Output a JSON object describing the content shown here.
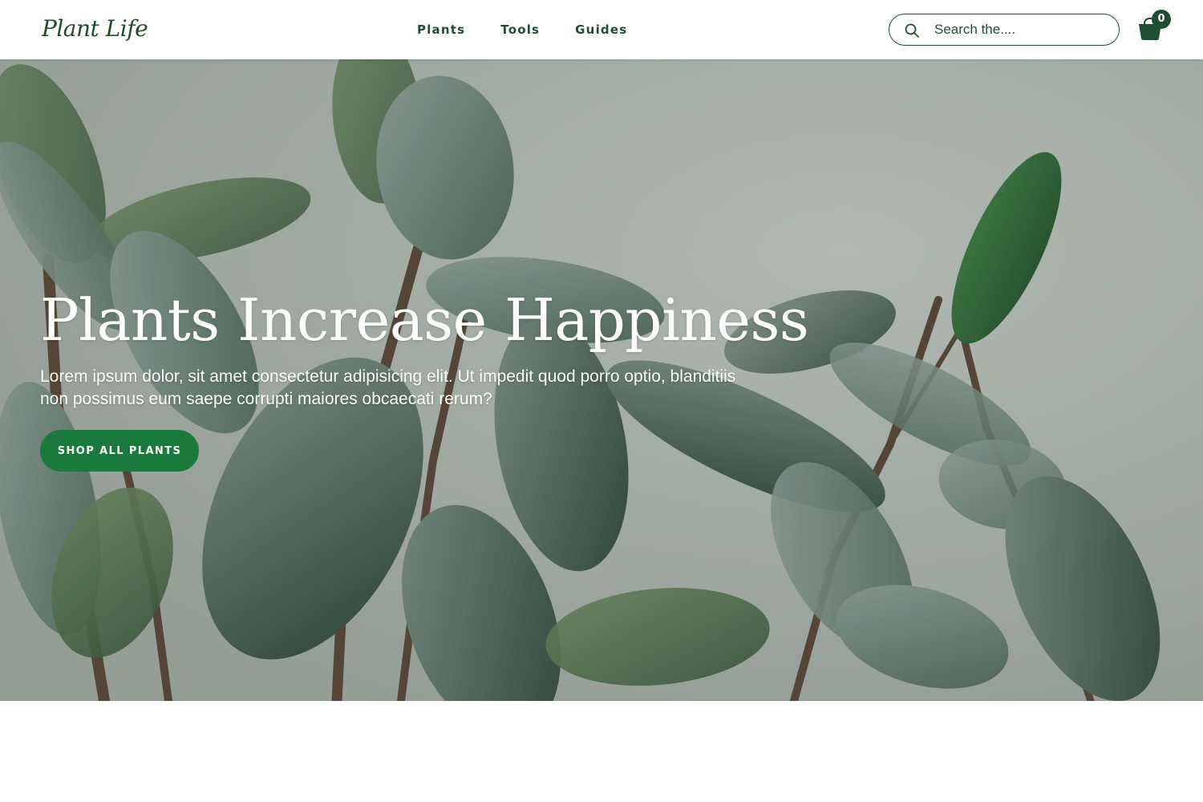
{
  "header": {
    "logo": "Plant Life",
    "nav": [
      "Plants",
      "Tools",
      "Guides"
    ],
    "search": {
      "placeholder": "Search the....",
      "value": ""
    },
    "cart": {
      "count": "0",
      "icon": "basket-icon"
    }
  },
  "hero": {
    "title": "Plants Increase Happiness",
    "text": "Lorem ipsum dolor, sit amet consectetur adipisicing elit. Ut impedit quod porro optio, blanditiis non possimus eum saepe corrupti maiores obcaecati rerum?",
    "cta": "SHOP ALL PLANTS",
    "background_image": "rubber plant leaves against a pale grey-green wall"
  },
  "colors": {
    "brand_dark_green": "#1e4f32",
    "button_green": "#1a7a3e",
    "hero_background": "#a9b3ac",
    "header_background": "#ffffff"
  }
}
